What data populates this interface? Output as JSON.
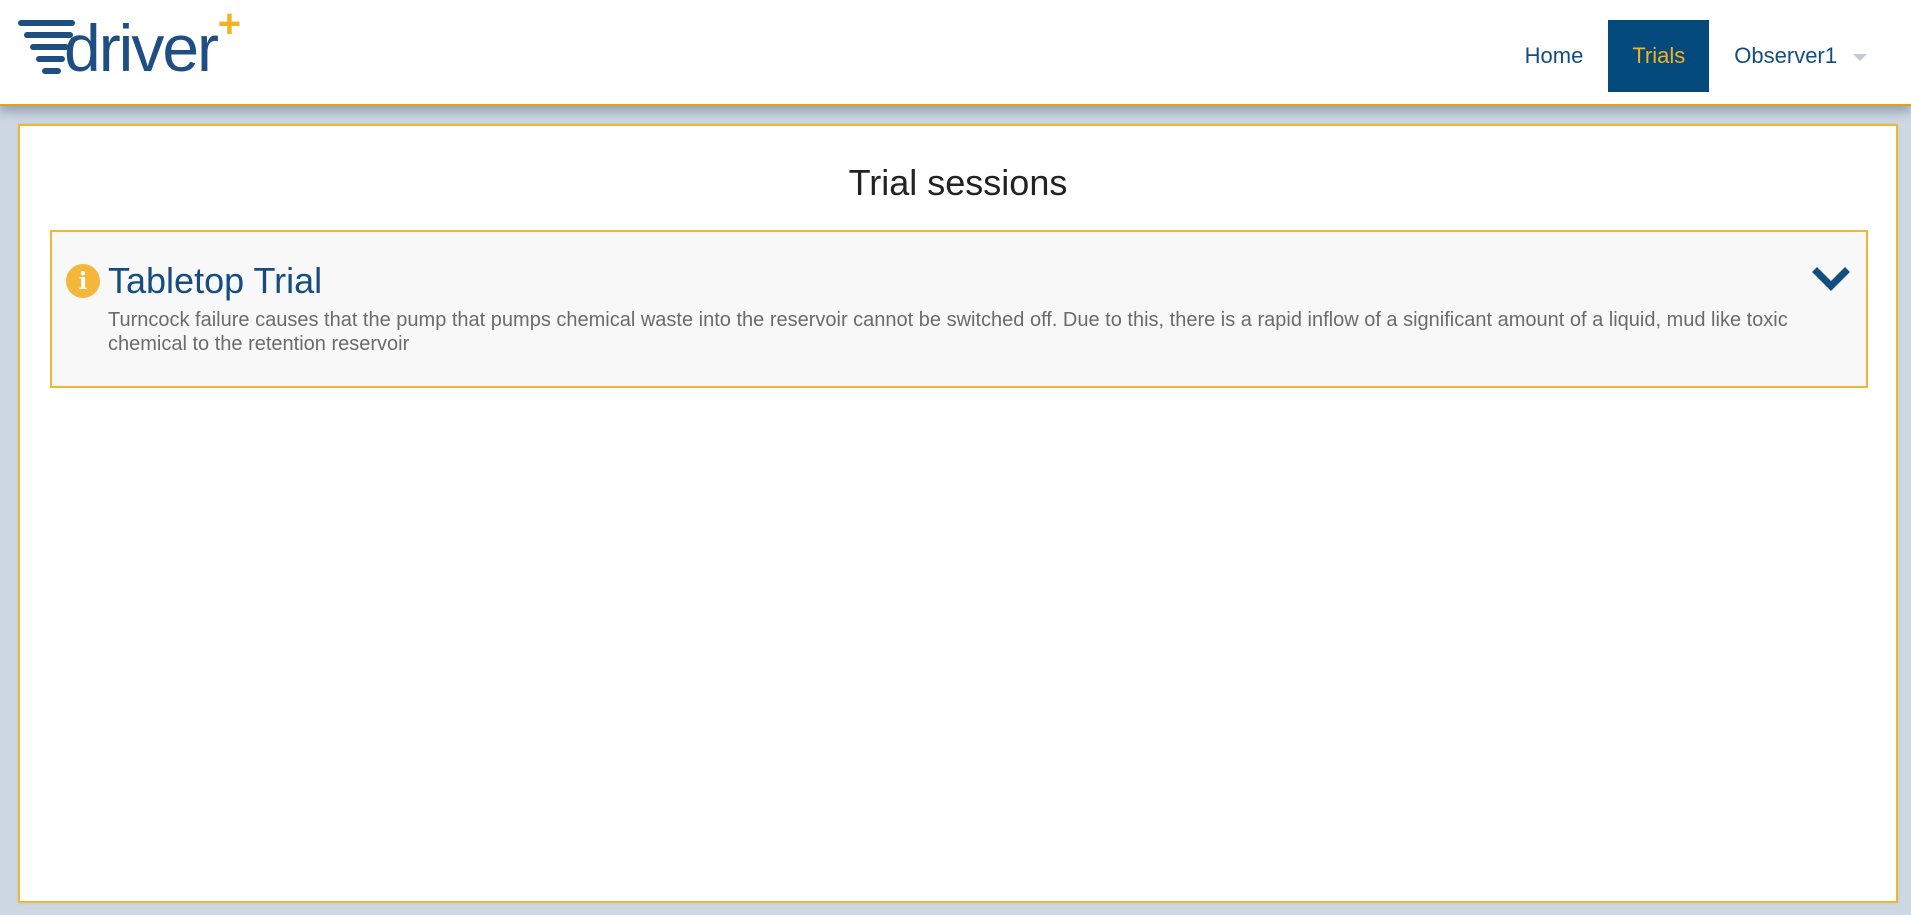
{
  "header": {
    "logo_text": "driver",
    "logo_plus": "+",
    "nav": {
      "home_label": "Home",
      "trials_label": "Trials",
      "user_label": "Observer1"
    }
  },
  "main": {
    "title": "Trial sessions",
    "sessions": [
      {
        "title": "Tabletop Trial",
        "description": "Turncock failure causes that the pump that pumps chemical waste into the reservoir cannot be switched off. Due to this, there is a rapid inflow of a significant amount of a liquid, mud like toxic chemical to the retention reservoir",
        "icon": "info-icon",
        "expand_icon": "chevron-down-icon"
      }
    ]
  },
  "colors": {
    "brand_blue": "#044a7c",
    "accent_yellow": "#f5b120",
    "background": "#cdd8e3"
  }
}
